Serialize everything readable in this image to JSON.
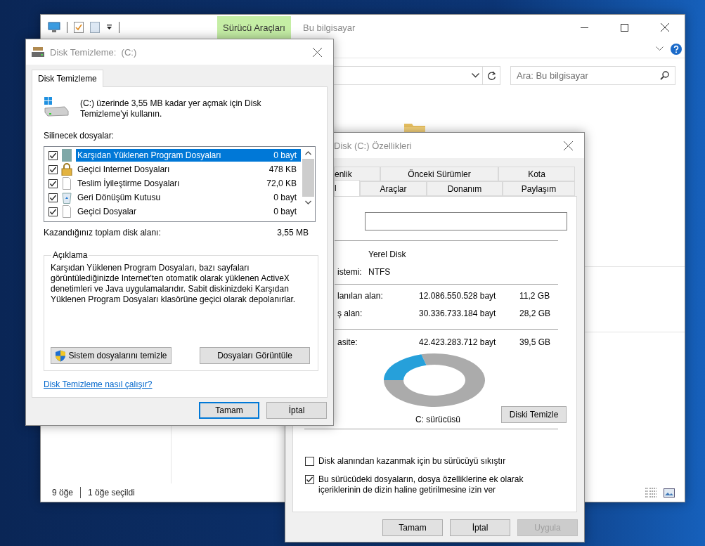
{
  "explorer": {
    "ribbon_tab": "Sürücü Araçları",
    "title": "Bu bilgisayar",
    "search": {
      "placeholder": "Ara: Bu bilgisayar"
    },
    "status_bar": {
      "item_count": "9 öğe",
      "selection": "1 öğe seçildi"
    }
  },
  "disk_cleanup": {
    "title": "Disk Temizleme:  (C:)",
    "tabs": [
      {
        "label": "Disk Temizleme",
        "selected": true
      }
    ],
    "intro": "(C:) üzerinde 3,55 MB kadar yer açmak için Disk Temizleme'yi kullanın.",
    "list_label": "Silinecek dosyalar:",
    "files": [
      {
        "kind": "program",
        "name": "Karşıdan Yüklenen Program Dosyaları",
        "size": "0 bayt",
        "checked": true,
        "selected": true
      },
      {
        "kind": "internet",
        "name": "Geçici Internet Dosyaları",
        "size": "478 KB",
        "checked": true,
        "selected": false
      },
      {
        "kind": "document",
        "name": "Teslim İyileştirme Dosyaları",
        "size": "72,0 KB",
        "checked": true,
        "selected": false
      },
      {
        "kind": "recycle",
        "name": "Geri Dönüşüm Kutusu",
        "size": "0 bayt",
        "checked": true,
        "selected": false
      },
      {
        "kind": "document",
        "name": "Geçici Dosyalar",
        "size": "0 bayt",
        "checked": true,
        "selected": false
      }
    ],
    "total_label": "Kazandığınız toplam disk alanı:",
    "total_value": "3,55 MB",
    "description_title": "Açıklama",
    "description": "Karşıdan Yüklenen Program Dosyaları, bazı sayfaları görüntülediğinizde Internet'ten otomatik olarak yüklenen ActiveX denetimleri ve Java uygulamalarıdır. Sabit diskinizdeki Karşıdan Yüklenen Program Dosyaları klasörüne geçici olarak depolanırlar.",
    "system_button": "Sistem dosyalarını temizle",
    "view_button": "Dosyaları Görüntüle",
    "help_link": "Disk Temizleme nasıl çalışır?",
    "buttons": [
      {
        "label": "Tamam",
        "default": true
      },
      {
        "label": "İptal",
        "default": false
      }
    ]
  },
  "properties": {
    "title": "Disk (C:) Özellikleri",
    "tab_rows": [
      [
        {
          "label": "enlik",
          "selected": false
        },
        {
          "label": "Önceki Sürümler",
          "selected": false
        },
        {
          "label": "Kota",
          "selected": false
        }
      ],
      [
        {
          "label": "l",
          "selected": true
        },
        {
          "label": "Araçlar",
          "selected": false
        },
        {
          "label": "Donanım",
          "selected": false
        },
        {
          "label": "Paylaşım",
          "selected": false
        }
      ]
    ],
    "type_value": "Yerel Disk",
    "filesystem": {
      "label": "istemi:",
      "value": "NTFS"
    },
    "space": [
      {
        "label": "lanılan alan:",
        "bytes": "12.086.550.528 bayt",
        "size": "11,2 GB"
      },
      {
        "label": "ş alan:",
        "bytes": "30.336.733.184 bayt",
        "size": "28,2 GB"
      }
    ],
    "capacity": {
      "label": "asite:",
      "bytes": "42.423.283.712 bayt",
      "size": "39,5 GB"
    },
    "drive_label": "C: sürücüsü",
    "cleanup_button": "Diski Temizle",
    "options": [
      {
        "label": "Disk alanından kazanmak için bu sürücüyü sıkıştır",
        "checked": false
      },
      {
        "label": "Bu sürücüdeki dosyaların, dosya özelliklerine ek olarak içeriklerinin de dizin haline getirilmesine izin ver",
        "checked": true
      }
    ],
    "buttons": [
      {
        "label": "Tamam",
        "disabled": false
      },
      {
        "label": "İptal",
        "disabled": false
      },
      {
        "label": "Uygula",
        "disabled": true
      }
    ]
  }
}
